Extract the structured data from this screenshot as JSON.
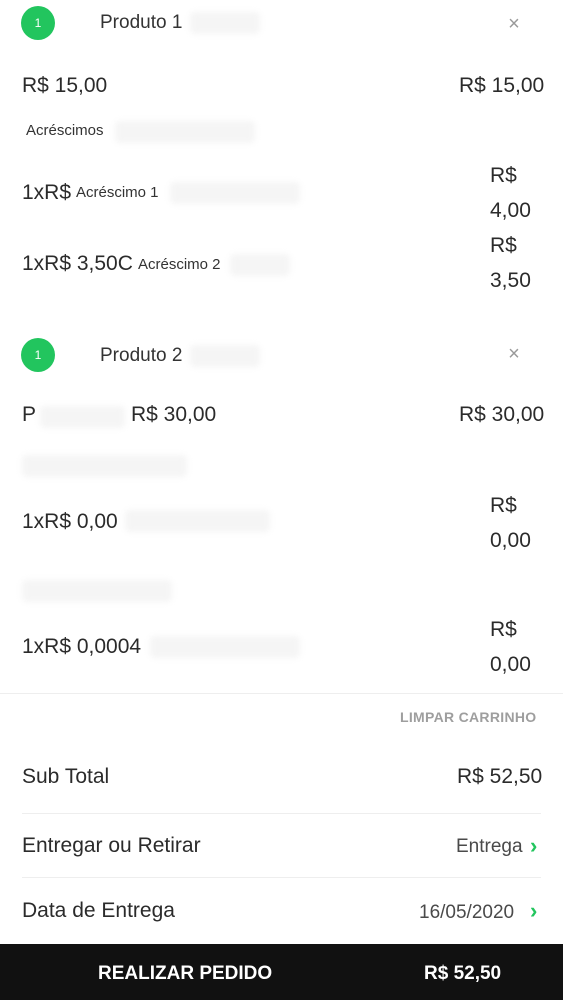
{
  "cart": {
    "products": [
      {
        "qty_badge": "1",
        "name": "Produto 1",
        "remove_icon": "×",
        "unit_price": "R$ 15,00",
        "line_total": "R$ 15,00",
        "addons_title": "Acréscimos",
        "addons": [
          {
            "prefix": "1xR$",
            "name": "Acréscimo 1",
            "total_currency": "R$",
            "total_amount": "4,00"
          },
          {
            "prefix": "1xR$ 3,50C",
            "name": "Acréscimo 2",
            "total_currency": "R$",
            "total_amount": "3,50"
          }
        ]
      },
      {
        "qty_badge": "1",
        "name": "Produto 2",
        "remove_icon": "×",
        "size": "P",
        "unit_price": "R$ 30,00",
        "line_total": "R$ 30,00",
        "addons": [
          {
            "prefix": "1xR$ 0,00",
            "total_currency": "R$",
            "total_amount": "0,00"
          },
          {
            "prefix": "1xR$ 0,0004",
            "total_currency": "R$",
            "total_amount": "0,00"
          }
        ]
      }
    ],
    "clear_cart_label": "LIMPAR CARRINHO"
  },
  "summary": {
    "subtotal_label": "Sub Total",
    "subtotal_value": "R$ 52,50",
    "delivery_label": "Entregar ou Retirar",
    "delivery_value": "Entrega",
    "date_label": "Data de Entrega",
    "date_value": "16/05/2020"
  },
  "order_button": {
    "label": "REALIZAR PEDIDO",
    "amount": "R$ 52,50"
  },
  "icons": {
    "chevron": "chevron-right-icon",
    "remove": "close-icon"
  },
  "colors": {
    "accent": "#22c55e",
    "order_bar": "#111111"
  }
}
